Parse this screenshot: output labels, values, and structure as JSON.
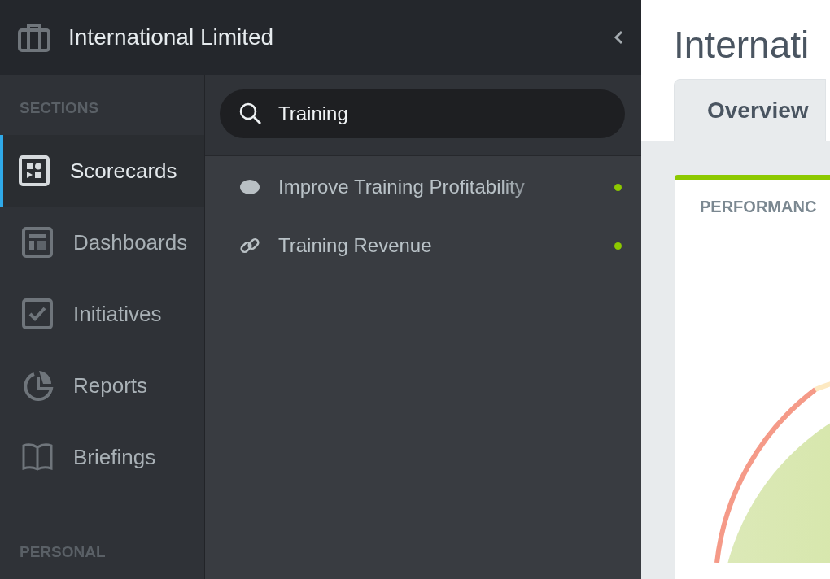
{
  "org": {
    "name": "International Limited"
  },
  "sidebar": {
    "sections_label": "SECTIONS",
    "items": [
      {
        "label": "Scorecards",
        "kind": "scorecard",
        "selected": true
      },
      {
        "label": "Dashboards",
        "kind": "dashboard",
        "selected": false
      },
      {
        "label": "Initiatives",
        "kind": "initiative",
        "selected": false
      },
      {
        "label": "Reports",
        "kind": "report",
        "selected": false
      },
      {
        "label": "Briefings",
        "kind": "briefing",
        "selected": false
      }
    ],
    "personal_label": "PERSONAL"
  },
  "search": {
    "value": "Training"
  },
  "results": [
    {
      "label": "Improve Training Profitability",
      "kind": "objective",
      "color": "#8dc900"
    },
    {
      "label": "Training Revenue",
      "kind": "measure",
      "color": "#8dc900"
    }
  ],
  "page": {
    "title": "Internati",
    "tabs": [
      {
        "label": "Overview",
        "selected": true
      }
    ],
    "card": {
      "title": "PERFORMANC"
    }
  }
}
